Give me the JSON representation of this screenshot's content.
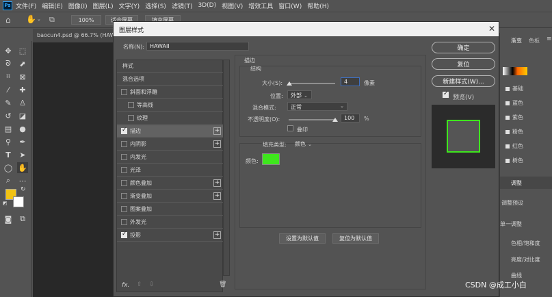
{
  "app": {
    "logo": "Ps",
    "menu": [
      "文件(F)",
      "编辑(E)",
      "图像(I)",
      "图层(L)",
      "文字(Y)",
      "选择(S)",
      "滤镜(T)",
      "3D(D)",
      "视图(V)",
      "增效工具",
      "窗口(W)",
      "帮助(H)"
    ]
  },
  "options_bar": {
    "zoom": "100%",
    "fit_screen": "适合屏幕",
    "fill_screen": "填充屏幕"
  },
  "document_tab": "baocun4.psd @ 66.7% (HAW",
  "dialog": {
    "title": "图层样式",
    "name_label": "名称(N):",
    "name_value": "HAWAII",
    "styles_list": [
      {
        "label": "样式",
        "checkbox": false,
        "checked": false,
        "plus": false,
        "indent": false,
        "active": false
      },
      {
        "label": "混合选项",
        "checkbox": false,
        "checked": false,
        "plus": false,
        "indent": false,
        "active": false
      },
      {
        "label": "斜面和浮雕",
        "checkbox": true,
        "checked": false,
        "plus": false,
        "indent": false,
        "active": false
      },
      {
        "label": "等高线",
        "checkbox": true,
        "checked": false,
        "plus": false,
        "indent": true,
        "active": false
      },
      {
        "label": "纹理",
        "checkbox": true,
        "checked": false,
        "plus": false,
        "indent": true,
        "active": false
      },
      {
        "label": "描边",
        "checkbox": true,
        "checked": true,
        "plus": true,
        "indent": false,
        "active": true
      },
      {
        "label": "内阴影",
        "checkbox": true,
        "checked": false,
        "plus": true,
        "indent": false,
        "active": false
      },
      {
        "label": "内发光",
        "checkbox": true,
        "checked": false,
        "plus": false,
        "indent": false,
        "active": false
      },
      {
        "label": "光泽",
        "checkbox": true,
        "checked": false,
        "plus": false,
        "indent": false,
        "active": false
      },
      {
        "label": "颜色叠加",
        "checkbox": true,
        "checked": false,
        "plus": true,
        "indent": false,
        "active": false
      },
      {
        "label": "渐变叠加",
        "checkbox": true,
        "checked": false,
        "plus": true,
        "indent": false,
        "active": false
      },
      {
        "label": "图案叠加",
        "checkbox": true,
        "checked": false,
        "plus": false,
        "indent": false,
        "active": false
      },
      {
        "label": "外发光",
        "checkbox": true,
        "checked": false,
        "plus": false,
        "indent": false,
        "active": false
      },
      {
        "label": "投影",
        "checkbox": true,
        "checked": true,
        "plus": true,
        "indent": false,
        "active": false
      }
    ],
    "stroke": {
      "section_title": "描边",
      "structure_title": "结构",
      "size_label": "大小(S):",
      "size_value": "4",
      "size_unit": "像素",
      "size_slider_fraction": 0.02,
      "position_label": "位置:",
      "position_value": "外部",
      "blend_label": "混合模式:",
      "blend_value": "正常",
      "opacity_label": "不透明度(O):",
      "opacity_value": "100",
      "opacity_unit": "%",
      "opacity_slider_fraction": 1.0,
      "overprint_label": "叠印",
      "fill_type_label": "填充类型:",
      "fill_type_value": "颜色",
      "color_label": "颜色:",
      "color": "#3ee61d"
    },
    "set_default": "设置为默认值",
    "reset_default": "复位为默认值",
    "ok": "确定",
    "reset": "复位",
    "new_style": "新建样式(W)...",
    "preview_label": "预览(V)",
    "preview_checked": true,
    "preview_stroke_color": "#3ee61d",
    "footer_fx": "fx."
  },
  "right_panel": {
    "tab_gradient": "渐变",
    "tab_swatches": "色板",
    "gradient_items": [
      "基础",
      "蓝色",
      "紫色",
      "粉色",
      "红色",
      "树色"
    ],
    "adjust_tab": "调整",
    "adjust_preset": "调整预设",
    "adjust_single": "单一调整",
    "adjust_items": [
      "色相/饱和度",
      "亮度/对比度",
      "曲线"
    ]
  },
  "watermark": "CSDN @成工小白",
  "colors": {
    "foreground": "#f2c314",
    "background": "#ffffff",
    "accent_field": "#3f6fbf"
  }
}
